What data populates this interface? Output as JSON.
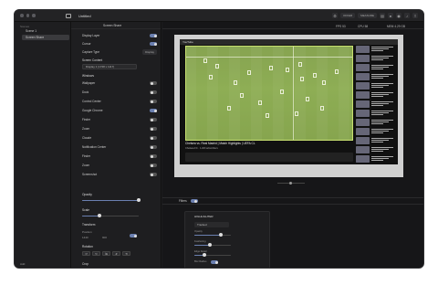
{
  "window": {
    "title": "Untitled",
    "toolbar_pills": [
      "OFFER",
      "MEASURE"
    ]
  },
  "sidebar": {
    "section": "Scenes",
    "items": [
      {
        "label": "Scene 1"
      },
      {
        "label": "Screen Share"
      }
    ],
    "add_label": "Add"
  },
  "panel": {
    "header": "Screen Share",
    "display_layer": "Display Layer",
    "cursor": "Cursor",
    "capture_type_label": "Capture Type",
    "capture_type_value": "Display",
    "screen_content": "Screen Content",
    "screen_select": "Display 1 (1728 x 1117)",
    "windows_label": "Windows",
    "windows": [
      "Wallpaper",
      "Dock",
      "Control Center",
      "Google Chrome",
      "Finder",
      "Zoom",
      "Claude",
      "Notification Center",
      "Finder",
      "Zoom",
      "Screenshot"
    ],
    "opacity_label": "Opacity",
    "opacity_value": 1,
    "scale_label": "Scale",
    "scale_value": 1.0,
    "transform_label": "Transform",
    "position_label": "Position",
    "x_label": "X",
    "x_value": "1440",
    "y_label": "Y",
    "y_value": "900",
    "rotation_label": "Rotation",
    "crop_label": "Crop"
  },
  "stats": {
    "fps": "FPS 53",
    "cpu": "CPU 58",
    "mem": "MEM 4.29 GB"
  },
  "video": {
    "title": "Chelsea vs. Real Madrid | Match Highlights | UEFA CL",
    "meta": "Chelsea FC · 1.2M subscribers",
    "top": "YouTube"
  },
  "filters": {
    "label": "Filters",
    "card_title": "HIGHLIGHTER",
    "card_select": "Tracked",
    "labels": [
      "Opacity",
      "Feathering",
      "Edge Detail",
      "Blur Radius"
    ]
  },
  "colors": {
    "accent": "#6a7fb0",
    "field": "#84a850"
  }
}
